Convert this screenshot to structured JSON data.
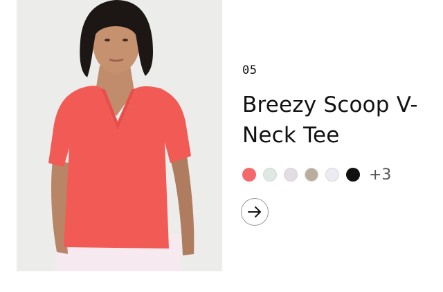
{
  "product": {
    "index": "05",
    "title": "Breezy Scoop V-Neck Tee",
    "swatches": [
      {
        "name": "coral",
        "color": "#f46a6a"
      },
      {
        "name": "mint",
        "color": "#dfe9e4"
      },
      {
        "name": "lavender-gray",
        "color": "#e2dde2"
      },
      {
        "name": "khaki",
        "color": "#b9ad9c"
      },
      {
        "name": "pale-lilac",
        "color": "#ecebf4"
      },
      {
        "name": "black",
        "color": "#111111"
      }
    ],
    "more_colors": "+3",
    "arrow_icon": "arrow-right-icon",
    "image_icon": "model-photo"
  }
}
